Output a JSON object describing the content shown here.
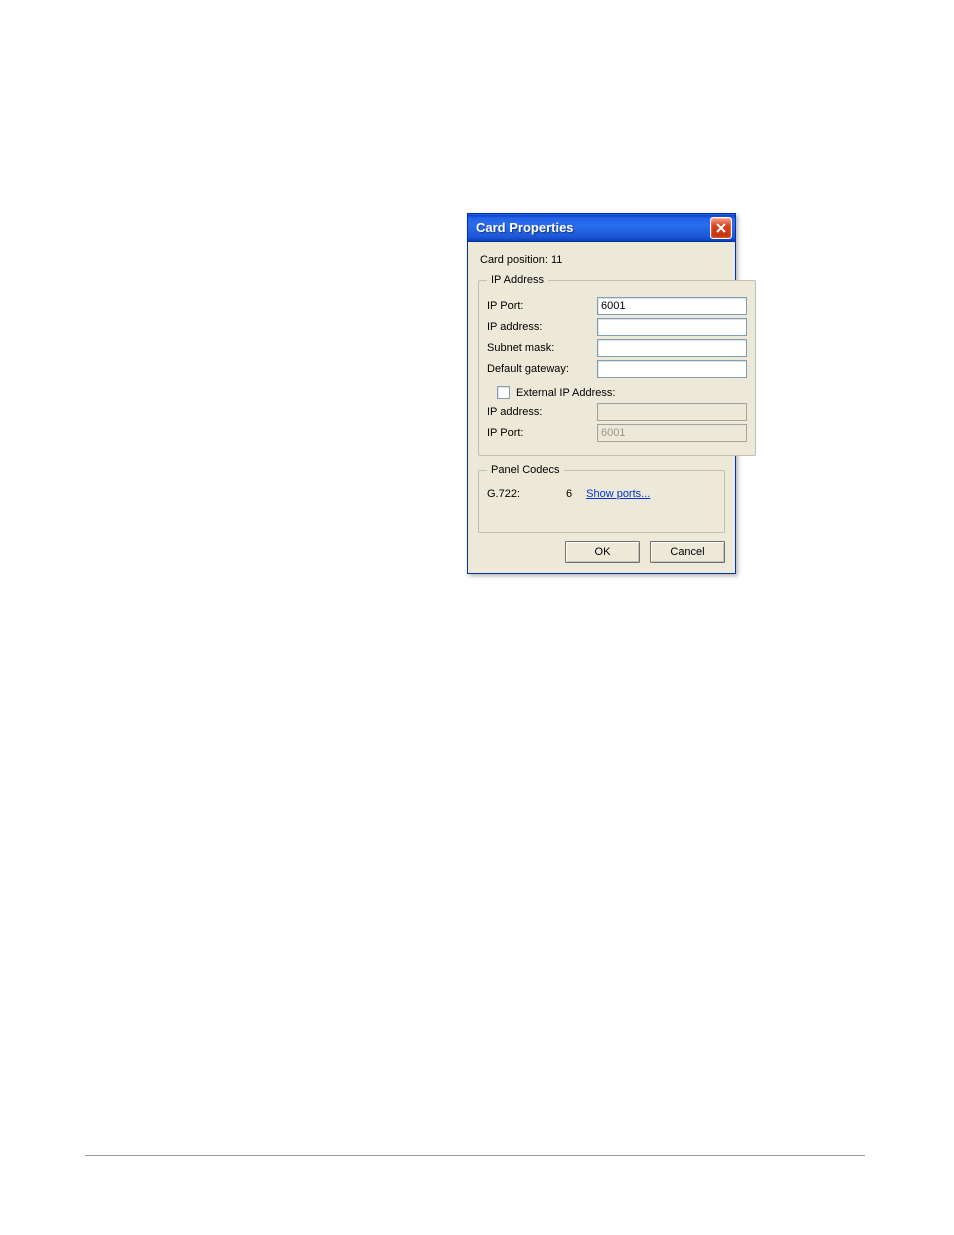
{
  "dialog_title": "Card Properties",
  "card_position_label": "Card position:",
  "card_position_value": "11",
  "groups": {
    "ip_address": {
      "legend": "IP Address",
      "fields": {
        "ip_port_label": "IP Port:",
        "ip_port_value": "6001",
        "ip_address_label": "IP address:",
        "ip_address_value": "",
        "subnet_label": "Subnet mask:",
        "subnet_value": "",
        "gateway_label": "Default gateway:",
        "gateway_value": ""
      },
      "external_checkbox_label": "External IP Address:",
      "external_checked": false,
      "ext_fields": {
        "ip_address_label": "IP address:",
        "ip_address_value": "",
        "ip_port_label": "IP Port:",
        "ip_port_value": "6001"
      }
    },
    "panel_codecs": {
      "legend": "Panel Codecs",
      "codec_label": "G.722:",
      "codec_count": "6",
      "show_ports_link": "Show ports..."
    }
  },
  "buttons": {
    "ok": "OK",
    "cancel": "Cancel"
  }
}
